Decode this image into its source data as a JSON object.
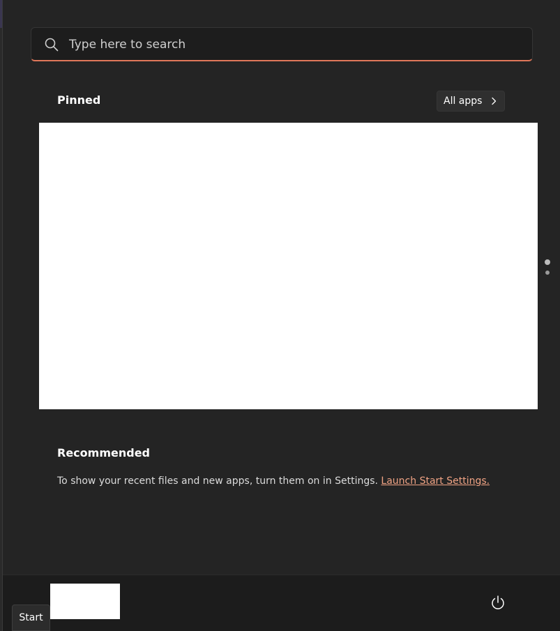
{
  "search": {
    "placeholder": "Type here to search",
    "icon": "search-icon",
    "accent_color": "#e0775a"
  },
  "pinned": {
    "title": "Pinned",
    "all_apps_label": "All apps",
    "all_apps_icon": "chevron-right-icon",
    "pages": 2,
    "current_page": 1
  },
  "recommended": {
    "title": "Recommended",
    "message": "To show your recent files and new apps, turn them on in Settings.",
    "link_label": "Launch Start Settings.",
    "link_color": "#f0a384"
  },
  "footer": {
    "power_icon": "power-icon"
  },
  "taskbar": {
    "start_tooltip": "Start"
  },
  "colors": {
    "menu_background": "#242424",
    "footer_background": "#1c1c1c"
  }
}
